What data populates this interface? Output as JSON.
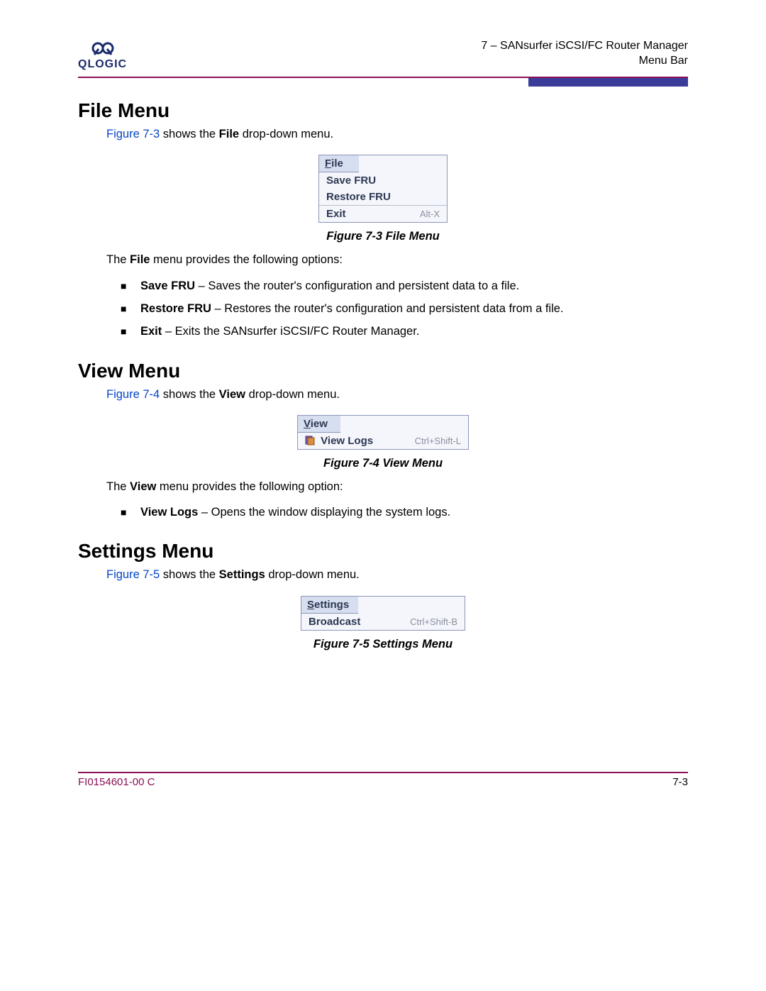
{
  "header": {
    "logo_word": "QLOGIC",
    "chapter_line": "7 – SANsurfer iSCSI/FC Router Manager",
    "section_line": "Menu Bar"
  },
  "sections": {
    "file": {
      "heading": "File Menu",
      "intro_link": "Figure 7-3",
      "intro_mid": " shows the ",
      "intro_bold": "File",
      "intro_tail": " drop-down menu.",
      "menu": {
        "title_u": "F",
        "title_rest": "ile",
        "items": [
          {
            "label": "Save FRU",
            "hint": ""
          },
          {
            "label": "Restore FRU",
            "hint": ""
          },
          {
            "label": "Exit",
            "hint": "Alt-X"
          }
        ]
      },
      "caption": "Figure 7-3  File Menu",
      "after_pre": "The ",
      "after_bold": "File",
      "after_post": " menu provides the following options:",
      "options": [
        {
          "name": "Save FRU",
          "desc": " – Saves the router's configuration and persistent data to a file."
        },
        {
          "name": "Restore FRU",
          "desc": " – Restores the router's configuration and persistent data from a file."
        },
        {
          "name": "Exit",
          "desc": " – Exits the SANsurfer iSCSI/FC Router Manager."
        }
      ]
    },
    "view": {
      "heading": "View Menu",
      "intro_link": "Figure 7-4",
      "intro_mid": " shows the ",
      "intro_bold": "View",
      "intro_tail": " drop-down menu.",
      "menu": {
        "title_u": "V",
        "title_rest": "iew",
        "items": [
          {
            "label": "View Logs",
            "hint": "Ctrl+Shift-L"
          }
        ]
      },
      "caption": "Figure 7-4  View Menu",
      "after_pre": "The ",
      "after_bold": "View",
      "after_post": " menu provides the following option:",
      "options": [
        {
          "name": "View Logs",
          "desc": " – Opens the window displaying the system logs."
        }
      ]
    },
    "settings": {
      "heading": "Settings Menu",
      "intro_link": "Figure 7-5",
      "intro_mid": " shows the ",
      "intro_bold": "Settings",
      "intro_tail": " drop-down menu.",
      "menu": {
        "title_u": "S",
        "title_rest": "ettings",
        "items": [
          {
            "label": "Broadcast",
            "hint": "Ctrl+Shift-B"
          }
        ]
      },
      "caption": "Figure 7-5  Settings Menu"
    }
  },
  "footer": {
    "doc": "FI0154601-00  C",
    "page": "7-3"
  }
}
